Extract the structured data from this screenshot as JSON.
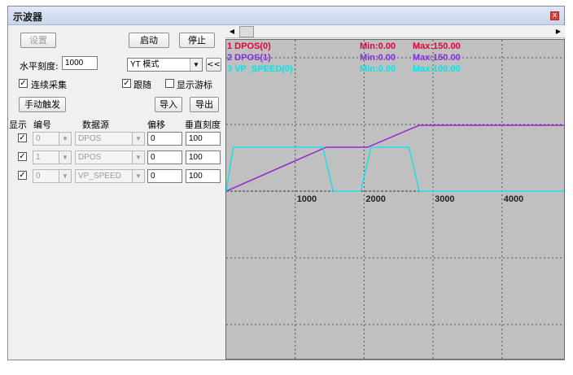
{
  "window": {
    "title": "示波器",
    "close_glyph": "x"
  },
  "toolbar": {
    "settings_label": "设置",
    "start_label": "启动",
    "stop_label": "停止",
    "horizontal_scale_label": "水平刻度:",
    "horizontal_scale_value": "1000",
    "mode_value": "YT 模式",
    "prev_label": "<<",
    "continuous_label": "连续采集",
    "continuous_checked": true,
    "follow_label": "跟随",
    "follow_checked": true,
    "cursor_label": "显示游标",
    "cursor_checked": false,
    "manual_trigger_label": "手动触发",
    "import_label": "导入",
    "export_label": "导出"
  },
  "channel_table": {
    "headers": {
      "show": "显示",
      "id": "编号",
      "source": "数据源",
      "offset": "偏移",
      "scale": "垂直刻度"
    },
    "rows": [
      {
        "checked": true,
        "id": "0",
        "source": "DPOS",
        "offset": "0",
        "scale": "100"
      },
      {
        "checked": true,
        "id": "1",
        "source": "DPOS",
        "offset": "0",
        "scale": "100"
      },
      {
        "checked": true,
        "id": "0",
        "source": "VP_SPEED",
        "offset": "0",
        "scale": "100"
      }
    ]
  },
  "scope": {
    "background": "#c0c0c0",
    "channels": [
      {
        "name": "1 DPOS(0)",
        "min": "Min:0.00",
        "max": "Max:150.00",
        "color": "#e8003c"
      },
      {
        "name": "2 DPOS(1)",
        "min": "Min:0.00",
        "max": "Max:150.00",
        "color": "#8a2be2"
      },
      {
        "name": "3 VP_SPEED(0)",
        "min": "Min:0.00",
        "max": "Max:100.00",
        "color": "#00e5ee"
      }
    ],
    "x_ticks": [
      "1000",
      "2000",
      "3000",
      "4000"
    ]
  },
  "chart_data": {
    "type": "line",
    "x_range": [
      0,
      4900
    ],
    "series": [
      {
        "name": "1 DPOS(0)",
        "color": "#e8003c",
        "x": [
          0,
          1450,
          2050,
          2800,
          4900
        ],
        "y": [
          0,
          100,
          100,
          150,
          150
        ]
      },
      {
        "name": "2 DPOS(1)",
        "color": "#8a2be2",
        "x": [
          0,
          1450,
          2050,
          2800,
          4900
        ],
        "y": [
          0,
          100,
          100,
          150,
          150
        ]
      },
      {
        "name": "3 VP_SPEED(0)",
        "color": "#00e5ee",
        "x": [
          0,
          100,
          1400,
          1550,
          1950,
          2100,
          2650,
          2800,
          4900
        ],
        "y": [
          0,
          100,
          100,
          0,
          0,
          100,
          100,
          0,
          0
        ]
      }
    ]
  }
}
